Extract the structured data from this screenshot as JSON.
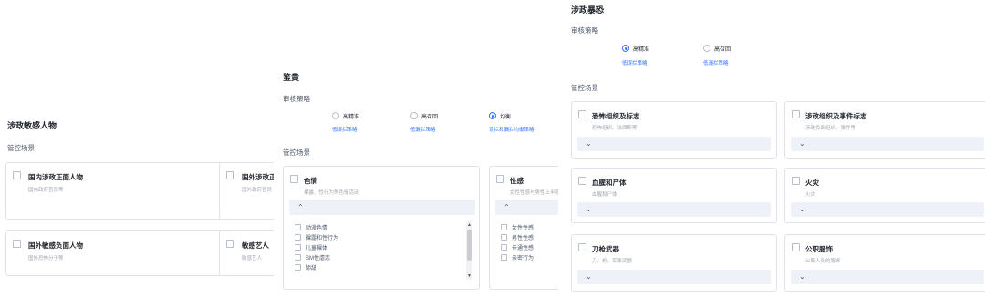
{
  "politics_people": {
    "title": "涉政敏感人物",
    "scene_label": "管控场景",
    "cards": [
      {
        "title": "国内涉政正面人物",
        "desc": "国内政府官员等"
      },
      {
        "title": "国外涉政正面",
        "desc": "国外政府官员"
      },
      {
        "title": "国外敏感负面人物",
        "desc": "国外恐怖分子等"
      },
      {
        "title": "敏感艺人",
        "desc": "敏感艺人"
      }
    ]
  },
  "porn": {
    "title": "鉴黄",
    "strategy_label": "审核策略",
    "options": [
      {
        "label": "高精准",
        "link": "低误拦策略"
      },
      {
        "label": "高召回",
        "link": "低漏拦策略"
      },
      {
        "label": "均衡",
        "link": "误拦和漏拦均衡策略"
      }
    ],
    "scene_label": "管控场景",
    "card_sex": {
      "title": "色情",
      "desc": "裸露、性行为等色情活动",
      "items": [
        "动漫色情",
        "裸露和性行为",
        "儿童裸体",
        "SM性虐恋",
        "舔舐"
      ]
    },
    "card_sexy": {
      "title": "性感",
      "desc": "女性性感与男性上半身裸体",
      "items": [
        "女性性感",
        "男性性感",
        "卡通性感",
        "亲密行为"
      ]
    }
  },
  "terror": {
    "title": "涉政暴恐",
    "strategy_label": "审核策略",
    "options": [
      {
        "label": "高精准",
        "link": "低误拦策略"
      },
      {
        "label": "高召回",
        "link": "低漏拦策略"
      }
    ],
    "scene_label": "管控场景",
    "cards": [
      {
        "title": "恐怖组织及标志",
        "desc": "恐怖组织、法西斯等"
      },
      {
        "title": "涉政组织及事件标志",
        "desc": "涉政负面组织、事件等"
      },
      {
        "title": "血腥和尸体",
        "desc": "血腥和尸体"
      },
      {
        "title": "火灾",
        "desc": "火灾"
      },
      {
        "title": "刀枪武器",
        "desc": "刀、枪、军事武器"
      },
      {
        "title": "公职服饰",
        "desc": "公职人员的服饰"
      }
    ]
  },
  "icons": {
    "chevron_down": "⌄",
    "chevron_up": "⌃"
  },
  "colors": {
    "accent": "#3370ff",
    "border": "#dfe2e8",
    "expand_bg": "#eef1f8"
  }
}
